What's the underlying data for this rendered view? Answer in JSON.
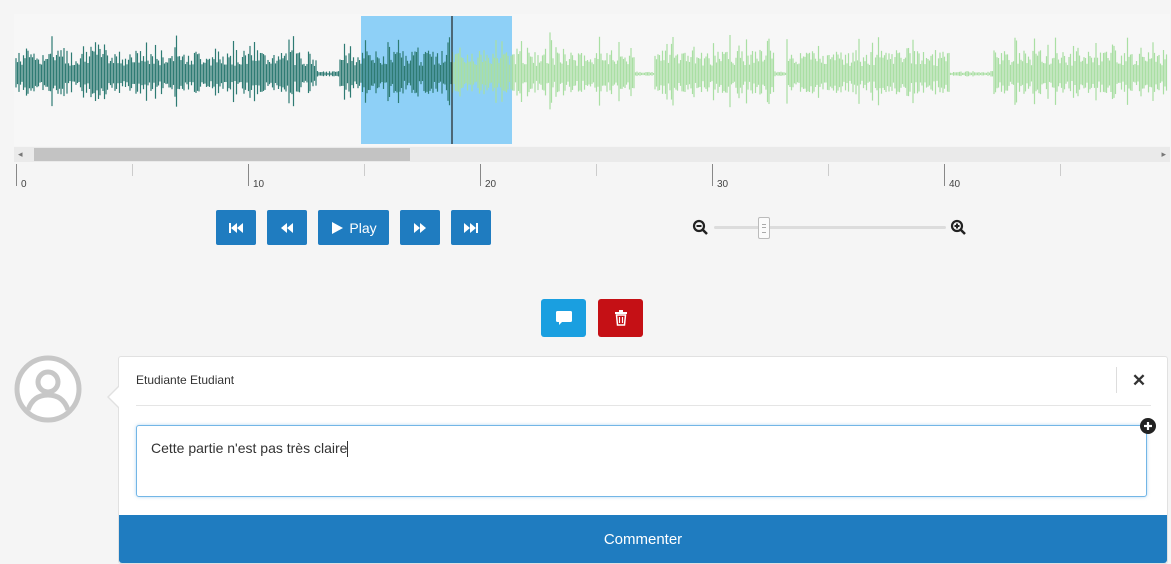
{
  "waveform": {
    "played_color": "#2e7b73",
    "unplayed_color": "#a9dfa3",
    "selection_color": "#8ed0f7",
    "cursor_color": "#222222"
  },
  "timeline": {
    "labels": [
      "0",
      "10",
      "20",
      "30",
      "40"
    ]
  },
  "transport": {
    "play_label": "Play",
    "buttons": [
      "skip-back",
      "rewind",
      "play",
      "fast-forward",
      "skip-forward"
    ]
  },
  "zoom": {
    "level": 0.21
  },
  "actions": {
    "comment_color": "#1a9fe0",
    "delete_color": "#c51015"
  },
  "comment": {
    "author": "Etudiante Etudiant",
    "text": "Cette partie n'est pas très claire",
    "submit_label": "Commenter"
  },
  "colors": {
    "primary": "#1f7cc0",
    "danger": "#c51015"
  }
}
